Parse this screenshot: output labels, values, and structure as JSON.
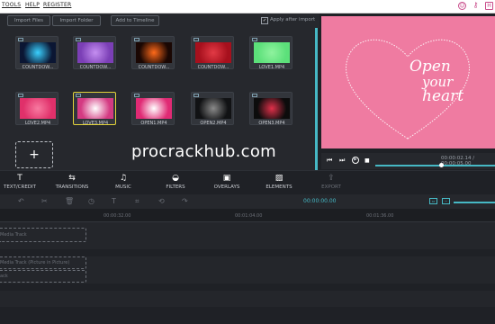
{
  "menu": {
    "items": [
      "TOOLS",
      "HELP",
      "REGISTER"
    ]
  },
  "toolbar": {
    "import_files": "Import Files",
    "import_folder": "Import Folder",
    "add_to_timeline": "Add to Timeline",
    "apply_after_import": "Apply after import",
    "apply_checked": true
  },
  "media": {
    "items": [
      {
        "label": "COUNTDOW...",
        "color": "#0b1633",
        "accent": "#3ad0ff"
      },
      {
        "label": "COUNTDOW...",
        "color": "#7b3fb6",
        "accent": "#c48ef0"
      },
      {
        "label": "COUNTDOW...",
        "color": "#1a0703",
        "accent": "#ff6a1a"
      },
      {
        "label": "COUNTDOW...",
        "color": "#a6101d",
        "accent": "#e23a45"
      },
      {
        "label": "LOVE1.MP4",
        "color": "#5ce07a",
        "accent": "#8ff29e"
      },
      {
        "label": "LOVE2.MP4",
        "color": "#e0306a",
        "accent": "#f77aa0"
      },
      {
        "label": "LOVE3.MP4",
        "color": "#d43a82",
        "accent": "#ffffff",
        "selected": true
      },
      {
        "label": "OPEN1.MP4",
        "color": "#e02a74",
        "accent": "#ffffff"
      },
      {
        "label": "OPEN2.MP4",
        "color": "#111214",
        "accent": "#8a8a8a"
      },
      {
        "label": "OPEN3.MP4",
        "color": "#0c0c0c",
        "accent": "#e0304a"
      }
    ],
    "add_icon": "+"
  },
  "preview": {
    "line1": "Open",
    "line2": "your",
    "line3": "heart",
    "background": "#ef7ba1",
    "time": "00:00:02.14 / 00:00:05.00",
    "progress": 0.55
  },
  "watermark": "procrackhub.com",
  "tabs": [
    {
      "label": "TEXT/CREDIT",
      "icon": "T"
    },
    {
      "label": "TRANSITIONS",
      "icon": "⇆"
    },
    {
      "label": "MUSIC",
      "icon": "♫"
    },
    {
      "label": "FILTERS",
      "icon": "◒"
    },
    {
      "label": "OVERLAYS",
      "icon": "▣"
    },
    {
      "label": "ELEMENTS",
      "icon": "▨"
    },
    {
      "label": "EXPORT",
      "icon": "⇪"
    }
  ],
  "timeline": {
    "timecode": "00:00:00.00",
    "ticks": [
      "00:00:32.00",
      "00:01:04.00",
      "00:01:36.00"
    ],
    "track_media": "Media Track",
    "track_pip": "Media Track (Picture in Picture)",
    "track_text": "ack"
  },
  "colors": {
    "accent": "#46b8c4",
    "selected": "#e2d33a",
    "brand": "#c84b8a"
  }
}
